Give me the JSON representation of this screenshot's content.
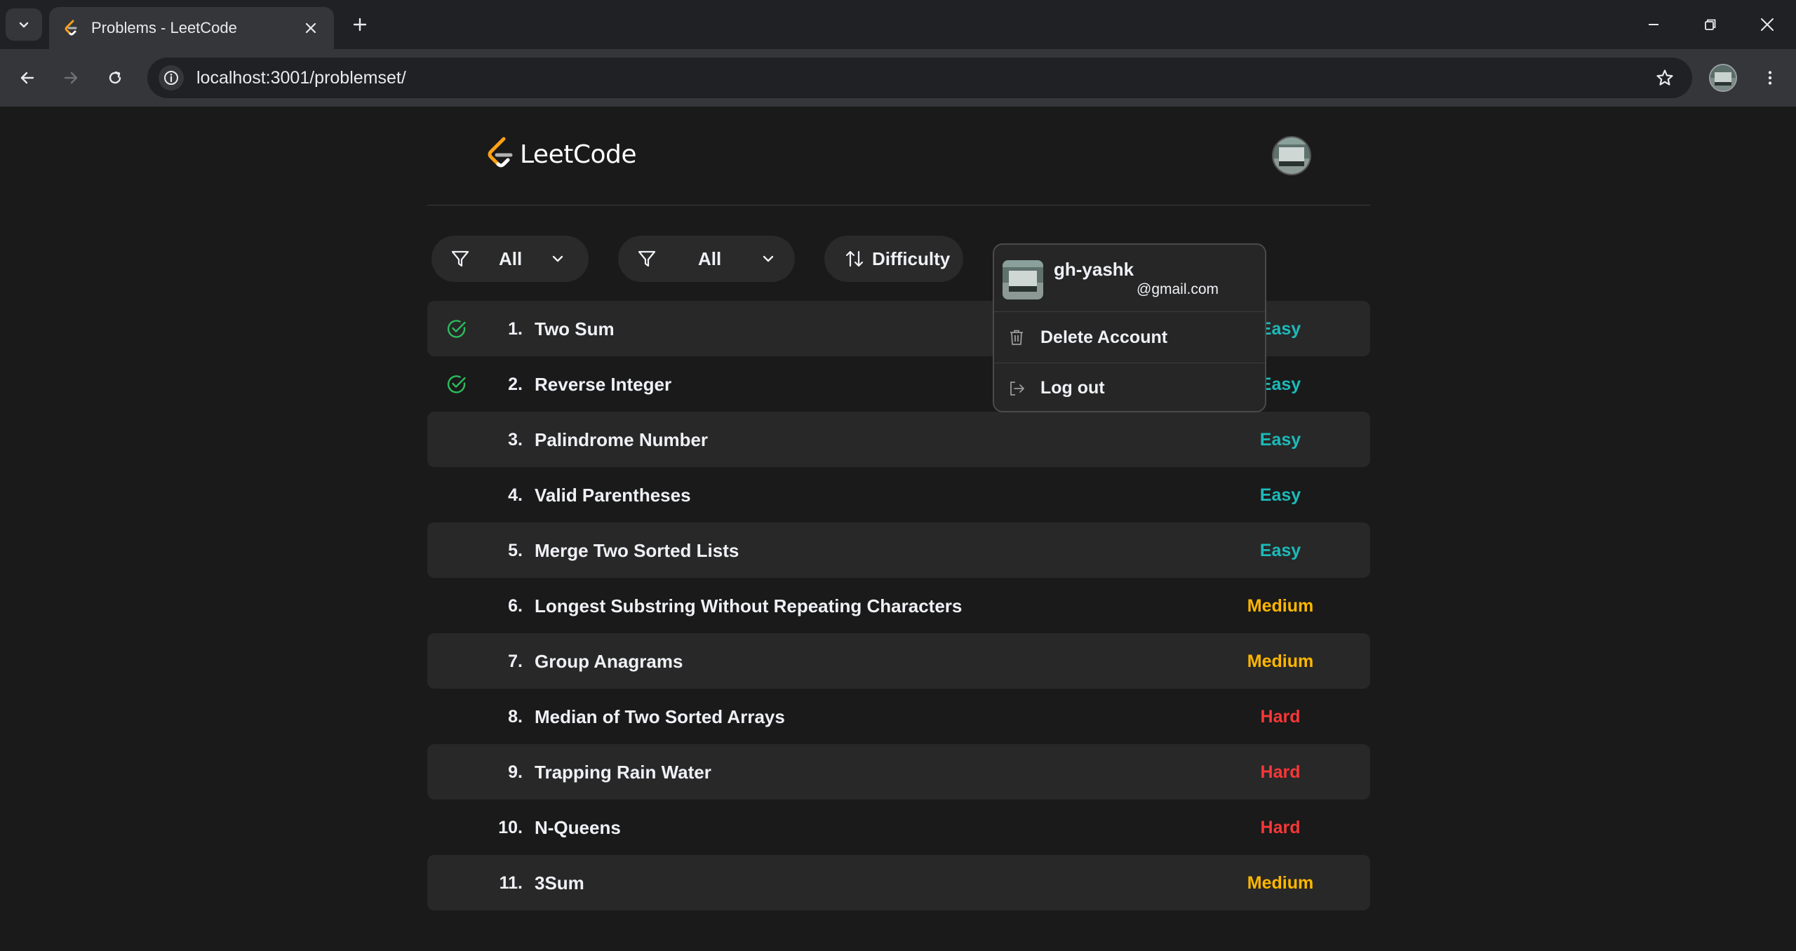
{
  "browser": {
    "tab_title": "Problems - LeetCode",
    "url": "localhost:3001/problemset/"
  },
  "header": {
    "logo_text": "LeetCode"
  },
  "filters": {
    "status_filter_value": "All",
    "tag_filter_value": "All",
    "sort_label": "Difficulty"
  },
  "user_menu": {
    "username": "gh-yashk",
    "email": "@gmail.com",
    "delete_label": "Delete Account",
    "logout_label": "Log out"
  },
  "colors": {
    "easy": "#1cbbba",
    "medium": "#ffb700",
    "hard": "#f63737",
    "solved": "#2cbb5d"
  },
  "problems": [
    {
      "num": "1.",
      "title": "Two Sum",
      "difficulty": "Easy",
      "solved": true
    },
    {
      "num": "2.",
      "title": "Reverse Integer",
      "difficulty": "Easy",
      "solved": true
    },
    {
      "num": "3.",
      "title": "Palindrome Number",
      "difficulty": "Easy",
      "solved": false
    },
    {
      "num": "4.",
      "title": "Valid Parentheses",
      "difficulty": "Easy",
      "solved": false
    },
    {
      "num": "5.",
      "title": "Merge Two Sorted Lists",
      "difficulty": "Easy",
      "solved": false
    },
    {
      "num": "6.",
      "title": "Longest Substring Without Repeating Characters",
      "difficulty": "Medium",
      "solved": false
    },
    {
      "num": "7.",
      "title": "Group Anagrams",
      "difficulty": "Medium",
      "solved": false
    },
    {
      "num": "8.",
      "title": "Median of Two Sorted Arrays",
      "difficulty": "Hard",
      "solved": false
    },
    {
      "num": "9.",
      "title": "Trapping Rain Water",
      "difficulty": "Hard",
      "solved": false
    },
    {
      "num": "10.",
      "title": "N-Queens",
      "difficulty": "Hard",
      "solved": false
    },
    {
      "num": "11.",
      "title": "3Sum",
      "difficulty": "Medium",
      "solved": false
    }
  ]
}
